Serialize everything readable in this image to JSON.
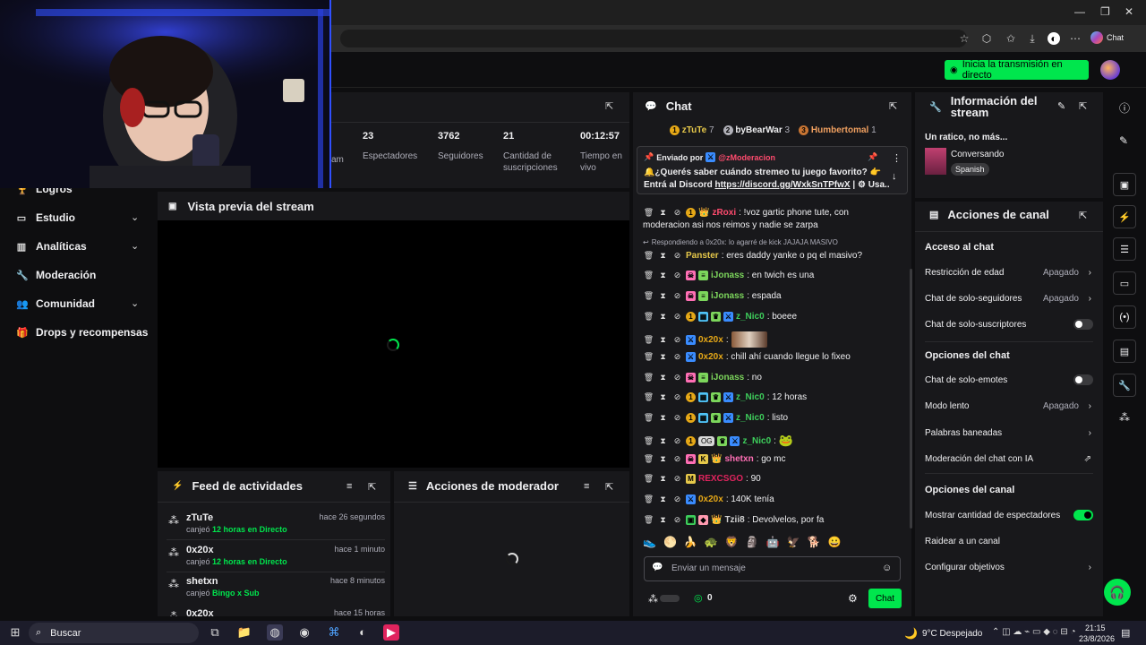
{
  "browser": {
    "copilot_label": "Chat"
  },
  "header": {
    "go_live": "Inicia la transmisión en directo"
  },
  "sidebar": {
    "items": [
      {
        "label": "Logros",
        "icon": "trophy-icon",
        "has_chevron": false
      },
      {
        "label": "Estudio",
        "icon": "monitor-icon",
        "has_chevron": true
      },
      {
        "label": "Analíticas",
        "icon": "bars-icon",
        "has_chevron": true
      },
      {
        "label": "Moderación",
        "icon": "wrench-icon",
        "has_chevron": false
      },
      {
        "label": "Comunidad",
        "icon": "people-icon",
        "has_chevron": true
      },
      {
        "label": "Drops y recompensas",
        "icon": "gift-icon",
        "has_chevron": false
      }
    ]
  },
  "stats": [
    {
      "value": "23",
      "label": "Espectadores"
    },
    {
      "value": "3762",
      "label": "Seguidores"
    },
    {
      "value": "21",
      "label": "Cantidad de suscripciones"
    },
    {
      "value": "00:12:57",
      "label": "Tiempo en vivo"
    }
  ],
  "stats_partial": "am",
  "preview": {
    "title": "Vista previa del stream"
  },
  "feed": {
    "title": "Feed de actividades",
    "items": [
      {
        "user": "zTuTe",
        "action": "canjeó",
        "reward": "12 horas en Directo",
        "time": "hace 26 segundos"
      },
      {
        "user": "0x20x",
        "action": "canjeó",
        "reward": "12 horas en Directo",
        "time": "hace 1 minuto"
      },
      {
        "user": "shetxn",
        "action": "canjeó",
        "reward": "Bingo x Sub",
        "time": "hace 8 minutos"
      },
      {
        "user": "0x20x",
        "action": "",
        "reward": "",
        "time": "hace 15 horas"
      }
    ]
  },
  "mod_actions": {
    "title": "Acciones de moderador"
  },
  "chat": {
    "title": "Chat",
    "leaders": [
      {
        "rank": "1",
        "name": "zTuTe",
        "count": "7",
        "color": "#e6a817"
      },
      {
        "rank": "2",
        "name": "byBearWar",
        "count": "3",
        "color": "#b0b0b8"
      },
      {
        "rank": "3",
        "name": "Humbertomal",
        "count": "1",
        "color": "#c87533"
      }
    ],
    "pinned": {
      "by_label": "Enviado por",
      "by_user": "@zModeracion",
      "line1": "🔔¿Querés saber cuándo stremeo tu juego favorito? 👉",
      "line2_prefix": "Entrá al Discord ",
      "link": "https://discord.gg/WxkSnTPfwX",
      "line2_suffix": " | ⚙ Usa..."
    },
    "messages": [
      {
        "user": "zRoxi",
        "color": "#ff4b6e",
        "text": ": !voz gartic phone tute, con",
        "cont": "moderacion asi nos reimos y nadie se zarpa"
      },
      {
        "reply": "Respondiendo a 0x20x: lo agarré de kick JAJAJA MASIVO"
      },
      {
        "user": "Panster",
        "color": "#e6c84a",
        "text": ": eres daddy yanke o pq el masivo?"
      },
      {
        "user": "iJonass",
        "color": "#7cd65c",
        "text": ": en twich es una"
      },
      {
        "user": "iJonass",
        "color": "#7cd65c",
        "text": ": espada"
      },
      {
        "user": "z_Nic0",
        "color": "#3ecf5c",
        "text": ": boeee"
      },
      {
        "user": "0x20x",
        "color": "#e6a817",
        "text": ":"
      },
      {
        "user": "0x20x",
        "color": "#e6a817",
        "text": ": chill ahí cuando llegue lo fixeo"
      },
      {
        "user": "iJonass",
        "color": "#7cd65c",
        "text": ": no"
      },
      {
        "user": "z_Nic0",
        "color": "#3ecf5c",
        "text": ": 12 horas"
      },
      {
        "user": "z_Nic0",
        "color": "#3ecf5c",
        "text": ": listo"
      },
      {
        "user": "z_Nic0",
        "color": "#3ecf5c",
        "text": ":"
      },
      {
        "user": "shetxn",
        "color": "#ff6fb5",
        "text": ": go mc"
      },
      {
        "user": "REXCSGO",
        "color": "#e0245e",
        "text": ": 90"
      },
      {
        "user": "0x20x",
        "color": "#e6a817",
        "text": ": 140K tenía"
      },
      {
        "user": "Tzii8",
        "color": "#d0d0d0",
        "text": ": Devolvelos, por fa"
      }
    ],
    "og_tooltip": "OG",
    "input_placeholder": "Enviar un mensaje",
    "points": "0",
    "send_label": "Chat"
  },
  "stream_info": {
    "title": "Información del stream",
    "stream_title": "Un ratico, no más...",
    "category": "Conversando",
    "language": "Spanish"
  },
  "channel_actions": {
    "title": "Acciones de canal",
    "sections": {
      "access": "Acceso al chat",
      "chat_options": "Opciones del chat",
      "channel_options": "Opciones del canal"
    },
    "rows": {
      "age": {
        "label": "Restricción de edad",
        "value": "Apagado"
      },
      "followers": {
        "label": "Chat de solo-seguidores",
        "value": "Apagado"
      },
      "subs": {
        "label": "Chat de solo-suscriptores"
      },
      "emotes": {
        "label": "Chat de solo-emotes"
      },
      "slow": {
        "label": "Modo lento",
        "value": "Apagado"
      },
      "banned": {
        "label": "Palabras baneadas"
      },
      "ai": {
        "label": "Moderación del chat con IA"
      },
      "viewers": {
        "label": "Mostrar cantidad de espectadores"
      },
      "raid": {
        "label": "Raidear a un canal"
      },
      "goals": {
        "label": "Configurar objetivos"
      }
    }
  },
  "taskbar": {
    "search": "Buscar",
    "weather": "9°C  Despejado",
    "time": "21:15",
    "date": "23/8/2026"
  }
}
